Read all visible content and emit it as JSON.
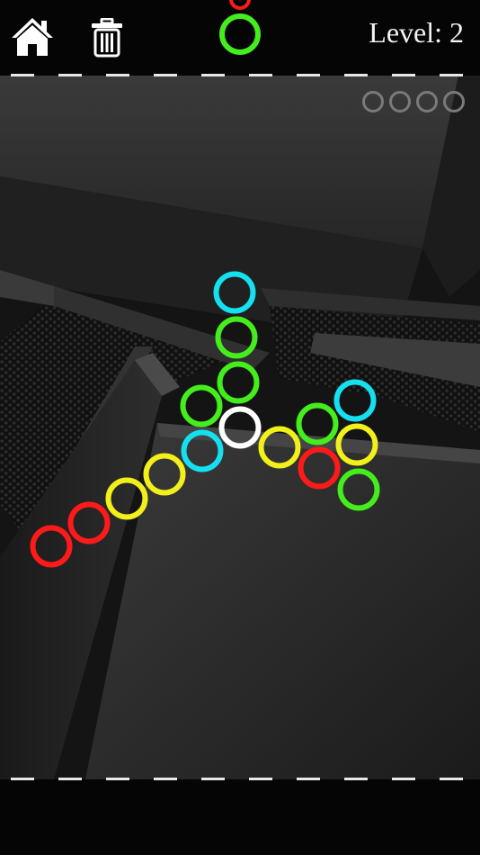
{
  "header": {
    "level_label": "Level: 2"
  },
  "icons": {
    "home": "home-icon",
    "trash": "trash-icon"
  },
  "colors": {
    "red": "#ff1a1a",
    "green": "#44ee1c",
    "cyan": "#14e0f0",
    "yellow": "#f2f01a",
    "white": "#ffffff",
    "empty_slot": "#7a7a7a"
  },
  "next_queue": [
    "red",
    "green"
  ],
  "reserve_slots": {
    "total": 4,
    "filled": 0
  },
  "board_rings": [
    "cyan",
    "green",
    "green",
    "green",
    "white",
    "cyan",
    "yellow",
    "yellow",
    "red",
    "red",
    "yellow",
    "red",
    "green",
    "cyan",
    "yellow",
    "green"
  ]
}
